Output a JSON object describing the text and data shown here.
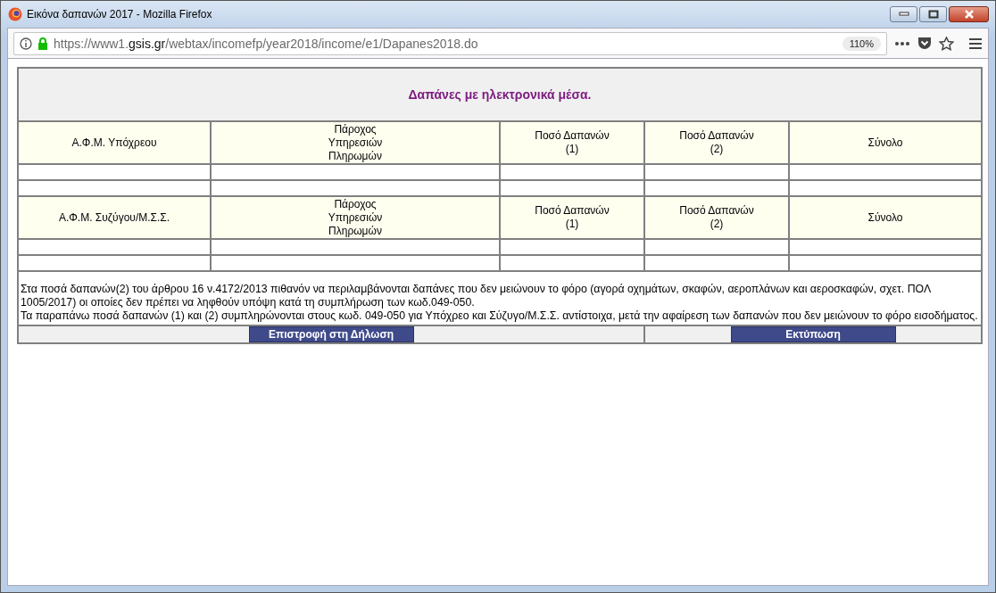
{
  "window": {
    "title": "Εικόνα δαπανών 2017 - Mozilla Firefox"
  },
  "address_bar": {
    "url_prefix": "https://www1.",
    "url_domain": "gsis.gr",
    "url_path": "/webtax/incomefp/year2018/income/e1/Dapanes2018.do",
    "zoom": "110%"
  },
  "page": {
    "heading": "Δαπάνες με ηλεκτρονικά μέσα.",
    "sections": [
      {
        "columns": [
          "Α.Φ.Μ. Υπόχρεου",
          "Πάροχος\nΥπηρεσιών\nΠληρωμών",
          "Ποσό Δαπανών\n(1)",
          "Ποσό Δαπανών\n(2)",
          "Σύνολο"
        ]
      },
      {
        "columns": [
          "Α.Φ.Μ. Συζύγου/Μ.Σ.Σ.",
          "Πάροχος\nΥπηρεσιών\nΠληρωμών",
          "Ποσό Δαπανών\n(1)",
          "Ποσό Δαπανών\n(2)",
          "Σύνολο"
        ]
      }
    ],
    "notes": [
      "Στα ποσά δαπανών(2) του άρθρου 16 ν.4172/2013 πιθανόν να περιλαμβάνονται δαπάνες που δεν μειώνουν το φόρο (αγορά οχημάτων, σκαφών, αεροπλάνων και αεροσκαφών, σχετ. ΠΟΛ 1005/2017) οι οποίες δεν πρέπει να ληφθούν υπόψη κατά τη συμπλήρωση των κωδ.049-050.",
      "Τα παραπάνω ποσά δαπανών (1) και (2) συμπληρώνονται στους κωδ. 049-050 για Υπόχρεο και Σύζυγο/Μ.Σ.Σ. αντίστοιχα, μετά την αφαίρεση των δαπανών που δεν μειώνουν το φόρο εισοδήματος."
    ],
    "buttons": [
      {
        "label": "Επιστροφή στη Δήλωση"
      },
      {
        "label": "Εκτύπωση"
      }
    ]
  }
}
